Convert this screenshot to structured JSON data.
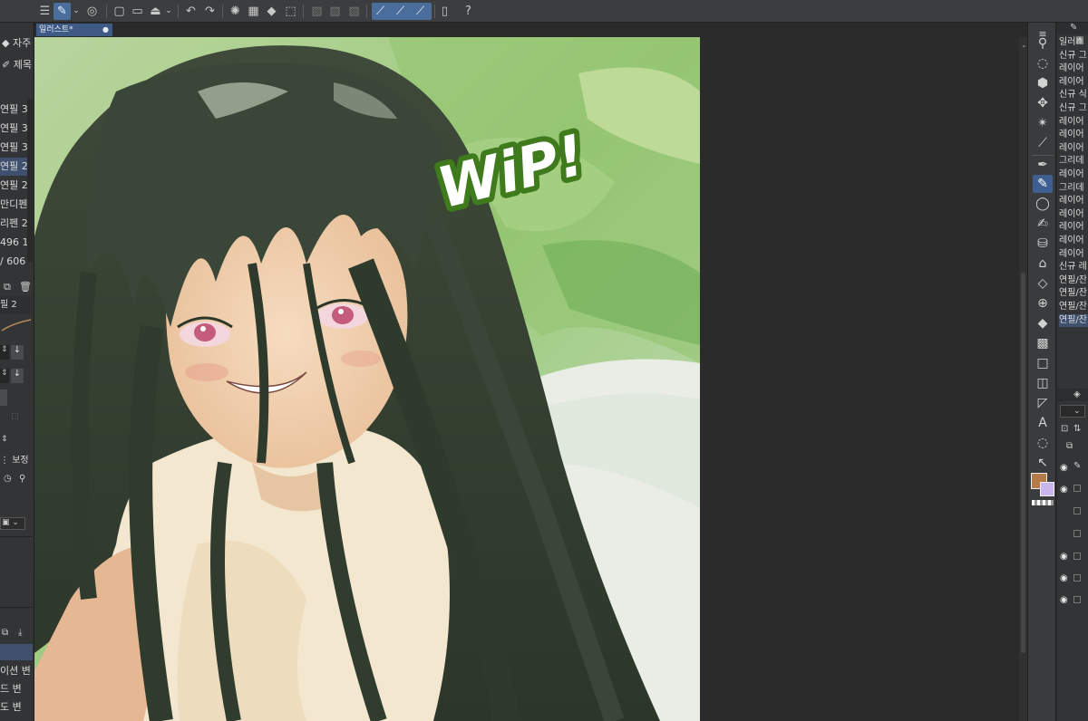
{
  "document": {
    "tab_label": "일러스트*"
  },
  "left_panel": {
    "top_items": [
      "자주",
      "제목"
    ],
    "brushes": [
      "연필 3",
      "연필 3",
      "연필 3",
      "연필 2",
      "연필 2",
      "만디펜",
      "리펜 2",
      "496 1",
      "/ 606"
    ],
    "selected_brush_index": 3,
    "prop_label": "필 2",
    "correction_label": "보정",
    "bottom_items": [
      "이션 변",
      "드 변",
      "도 변"
    ]
  },
  "sub_tool_list": {
    "items": [
      "일러스",
      "신규 그",
      "레이어",
      "레이어",
      "신규 식",
      "신규 그",
      "레이어",
      "레이어",
      "레이어",
      "그리데",
      "레이어",
      "그리데",
      "레이어",
      "레이어",
      "레이어",
      "레이어",
      "레이어",
      "신규 레",
      "연필/잔",
      "연필/잔",
      "연필/잔",
      "연필/잔"
    ],
    "selected_index": 21
  },
  "colors": {
    "main_color": "#b47a48",
    "sub_color": "#c9b6ea",
    "accent": "#3f5f92",
    "wip_text_fill": "#ffffff",
    "wip_text_stroke": "#3f7a1c"
  },
  "artwork": {
    "overlay_text": "WiP!"
  }
}
